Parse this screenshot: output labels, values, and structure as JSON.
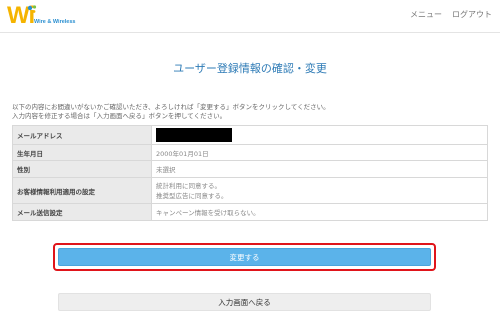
{
  "header": {
    "logo_text": "Wi",
    "logo_subtext": "Wire & Wireless",
    "menu_label": "メニュー",
    "logout_label": "ログアウト"
  },
  "page": {
    "title": "ユーザー登録情報の確認・変更",
    "instruction_1": "以下の内容にお間違いがないかご確認いただき、よろしければ「変更する」ボタンをクリックしてください。",
    "instruction_2": "入力内容を修正する場合は「入力画面へ戻る」ボタンを押してください。"
  },
  "table": {
    "rows": [
      {
        "label": "メールアドレス",
        "value": ""
      },
      {
        "label": "生年月日",
        "value": "2000年01月01日"
      },
      {
        "label": "性別",
        "value": "未選択"
      },
      {
        "label": "お客様情報利用適用の設定",
        "value_lines": [
          "統計利用に同意する。",
          "推奨型広告に同意する。"
        ]
      },
      {
        "label": "メール送信設定",
        "value": "キャンペーン情報を受け取らない。"
      }
    ]
  },
  "buttons": {
    "change_label": "変更する",
    "back_label": "入力画面へ戻る"
  },
  "colors": {
    "accent": "#5bb3ea",
    "title": "#2e7bb6",
    "highlight": "#e0141a",
    "logo": "#f5b400"
  }
}
